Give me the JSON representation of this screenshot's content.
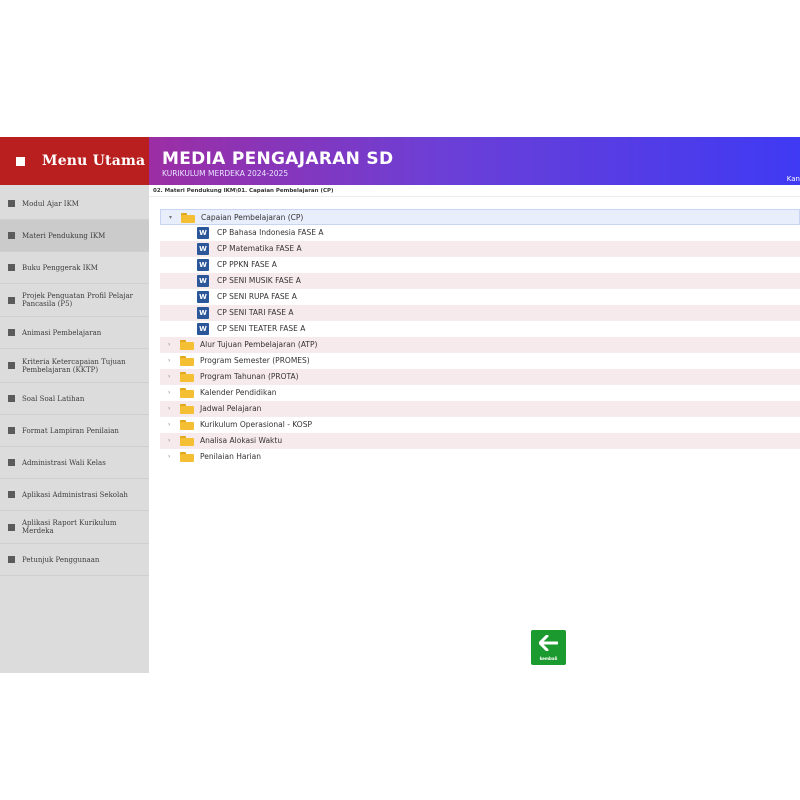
{
  "sidebar": {
    "title": "Menu Utama",
    "items": [
      {
        "label": "Modul Ajar IKM",
        "active": false
      },
      {
        "label": "Materi Pendukung IKM",
        "active": true
      },
      {
        "label": "Buku Penggerak IKM",
        "active": false
      },
      {
        "label": "Projek Penguatan Profil Pelajar Pancasila (P5)",
        "active": false
      },
      {
        "label": "Animasi Pembelajaran",
        "active": false
      },
      {
        "label": "Kriteria Ketercapaian Tujuan Pembelajaran (KKTP)",
        "active": false
      },
      {
        "label": "Soal Soal Latihan",
        "active": false
      },
      {
        "label": "Format Lampiran Penilaian",
        "active": false
      },
      {
        "label": "Administrasi Wali Kelas",
        "active": false
      },
      {
        "label": "Aplikasi Administrasi Sekolah",
        "active": false
      },
      {
        "label": "Aplikasi Raport Kurikulum Merdeka",
        "active": false
      },
      {
        "label": "Petunjuk Penggunaan",
        "active": false
      }
    ]
  },
  "header": {
    "title": "MEDIA PENGAJARAN SD",
    "subtitle": "KURIKULUM MERDEKA 2024-2025",
    "right_text": "Kan"
  },
  "path": "02. Materi Pendukung IKM\\01. Capaian Pembelajaran (CP)",
  "tree": {
    "expanded_folder": "Capaian Pembelajaran (CP)",
    "files": [
      "CP Bahasa Indonesia FASE A",
      "CP Matematika FASE A",
      "CP PPKN FASE A",
      "CP SENI MUSIK FASE A",
      "CP SENI RUPA FASE A",
      "CP SENI TARI FASE A",
      "CP SENI TEATER FASE A"
    ],
    "folders": [
      "Alur Tujuan Pembelajaran (ATP)",
      "Program Semester (PROMES)",
      "Program Tahunan (PROTA)",
      "Kalender Pendidikan",
      "Jadwal Pelajaran",
      "Kurikulum Operasional - KOSP",
      "Analisa Alokasi Waktu",
      "Penilaian Harian"
    ]
  },
  "back_button": {
    "label": "kembali"
  },
  "icons": {
    "sidebar_bullet": "square-bullet-icon",
    "folder": "folder-icon",
    "word": "word-doc-icon",
    "expand_open": "triangle-down-icon",
    "expand_closed": "triangle-right-icon",
    "back": "arrow-left-icon"
  },
  "colors": {
    "menu_red": "#b91f1f",
    "header_start": "#9c2ea4",
    "header_end": "#3f3af3",
    "sidebar_bg": "#dcdcdc",
    "back_green": "#1b9a2f",
    "folder_yellow": "#f4bf32",
    "word_blue": "#2b579a"
  }
}
